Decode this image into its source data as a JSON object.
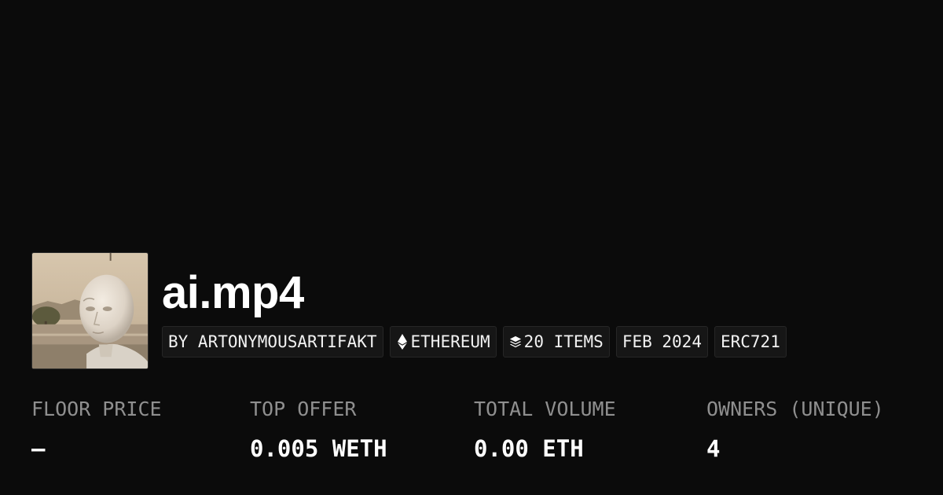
{
  "collection": {
    "title": "ai.mp4",
    "tags": [
      {
        "label": "BY ARTONYMOUSARTIFAKT",
        "icon": ""
      },
      {
        "label": "ETHEREUM",
        "icon": "ethereum-icon"
      },
      {
        "label": "20 ITEMS",
        "icon": "layers-icon"
      },
      {
        "label": "FEB 2024",
        "icon": ""
      },
      {
        "label": "ERC721",
        "icon": ""
      }
    ]
  },
  "stats": [
    {
      "label": "FLOOR PRICE",
      "value": "–"
    },
    {
      "label": "TOP OFFER",
      "value": "0.005 WETH"
    },
    {
      "label": "TOTAL VOLUME",
      "value": "0.00 ETH"
    },
    {
      "label": "OWNERS (UNIQUE)",
      "value": "4"
    }
  ],
  "colors": {
    "background": "#0b0b0b",
    "tag_background": "#161616",
    "label_gray": "#8f8f8f",
    "text_white": "#ffffff"
  }
}
